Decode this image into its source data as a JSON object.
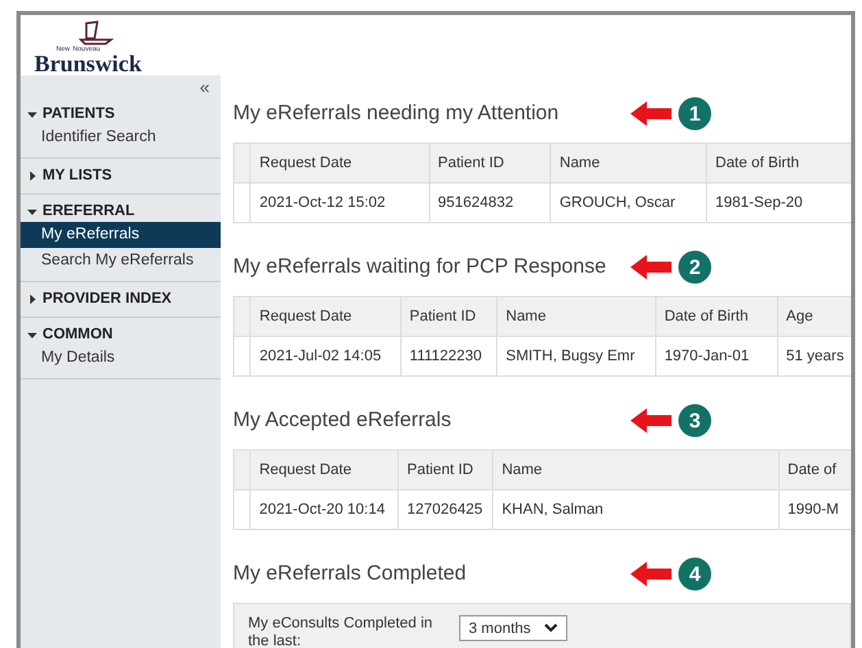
{
  "logo": {
    "top_left": "New",
    "top_right": "Nouveau",
    "name": "Brunswick"
  },
  "sidebar": {
    "collapse": "«",
    "groups": [
      {
        "label": "PATIENTS",
        "expanded": true,
        "items": [
          {
            "label": "Identifier Search",
            "selected": false
          }
        ]
      },
      {
        "label": "MY LISTS",
        "expanded": false
      },
      {
        "label": "EREFERRAL",
        "expanded": true,
        "items": [
          {
            "label": "My eReferrals",
            "selected": true
          },
          {
            "label": "Search My eReferrals",
            "selected": false
          }
        ]
      },
      {
        "label": "PROVIDER INDEX",
        "expanded": false
      },
      {
        "label": "COMMON",
        "expanded": true,
        "items": [
          {
            "label": "My Details",
            "selected": false
          }
        ]
      }
    ]
  },
  "sections": [
    {
      "kind": "table",
      "title": "My eReferrals needing my Attention",
      "marker": "1",
      "columns": [
        "Request Date",
        "Patient ID",
        "Name",
        "Date of Birth"
      ],
      "rows": [
        [
          "2021-Oct-12 15:02",
          "951624832",
          "GROUCH, Oscar",
          "1981-Sep-20"
        ]
      ]
    },
    {
      "kind": "table",
      "title": "My eReferrals waiting for PCP Response",
      "marker": "2",
      "columns": [
        "Request Date",
        "Patient ID",
        "Name",
        "Date of Birth",
        "Age"
      ],
      "rows": [
        [
          "2021-Jul-02 14:05",
          "111122230",
          "SMITH, Bugsy Emr",
          "1970-Jan-01",
          "51 years"
        ]
      ]
    },
    {
      "kind": "table",
      "title": "My Accepted eReferrals",
      "marker": "3",
      "columns": [
        "Request Date",
        "Patient ID",
        "Name",
        "Date of"
      ],
      "rows": [
        [
          "2021-Oct-20 10:14",
          "127026425",
          "KHAN, Salman",
          "1990-M"
        ]
      ]
    },
    {
      "kind": "filter",
      "title": "My eReferrals Completed",
      "marker": "4",
      "label": "My eConsults Completed in the last:",
      "value": "3 months"
    }
  ]
}
